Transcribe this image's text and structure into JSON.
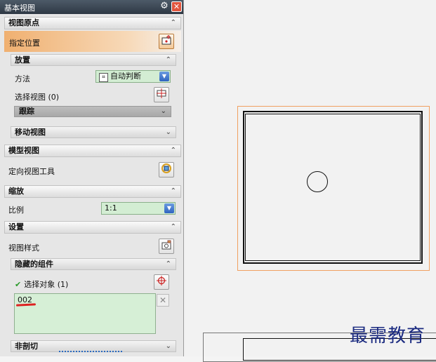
{
  "dialog": {
    "title": "基本视图",
    "sections": {
      "origin": {
        "title": "视图原点",
        "specify_location": "指定位置",
        "placement": {
          "title": "放置",
          "method_label": "方法",
          "method_value": "自动判断",
          "select_view_label": "选择视图 (0)",
          "tracking": "跟踪"
        },
        "move_view": "移动视图"
      },
      "model_view": {
        "title": "模型视图",
        "orient_tool": "定向视图工具"
      },
      "scale": {
        "title": "缩放",
        "ratio_label": "比例",
        "ratio_value": "1:1"
      },
      "settings": {
        "title": "设置",
        "view_style": "视图样式",
        "hidden_components": {
          "title": "隐藏的组件",
          "select_objects": "选择对象 (1)",
          "list_items": [
            "002"
          ]
        },
        "non_section": "非剖切"
      }
    }
  },
  "watermark": "最需教育",
  "colors": {
    "highlight": "#f0b070",
    "list_bg": "#d6efd6",
    "titlebar": "#3a4552",
    "close": "#e2553d"
  }
}
